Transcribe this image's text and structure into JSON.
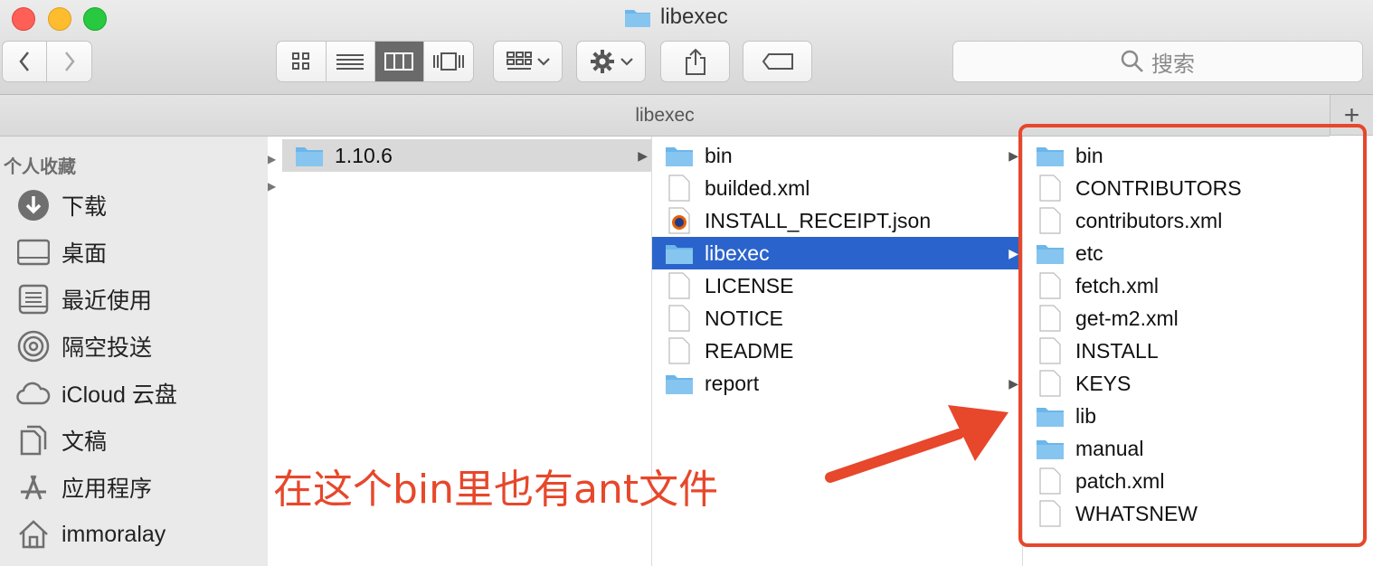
{
  "window": {
    "title": "libexec",
    "path_title": "libexec"
  },
  "toolbar": {
    "search_placeholder": "搜索",
    "plus_label": "+"
  },
  "sidebar": {
    "header": "个人收藏",
    "items": [
      {
        "label": "下载",
        "icon": "download-icon"
      },
      {
        "label": "桌面",
        "icon": "desktop-icon"
      },
      {
        "label": "最近使用",
        "icon": "recents-icon"
      },
      {
        "label": "隔空投送",
        "icon": "airdrop-icon"
      },
      {
        "label": "iCloud 云盘",
        "icon": "cloud-icon"
      },
      {
        "label": "文稿",
        "icon": "documents-icon"
      },
      {
        "label": "应用程序",
        "icon": "applications-icon"
      },
      {
        "label": "immoralay",
        "icon": "home-icon"
      }
    ]
  },
  "columns": {
    "col1": [
      {
        "name": "1.10.6",
        "type": "folder"
      }
    ],
    "col2": [
      {
        "name": "bin",
        "type": "folder"
      },
      {
        "name": "builded.xml",
        "type": "file"
      },
      {
        "name": "INSTALL_RECEIPT.json",
        "type": "json"
      },
      {
        "name": "libexec",
        "type": "folder"
      },
      {
        "name": "LICENSE",
        "type": "file"
      },
      {
        "name": "NOTICE",
        "type": "file"
      },
      {
        "name": "README",
        "type": "file"
      },
      {
        "name": "report",
        "type": "folder"
      }
    ],
    "col3": [
      {
        "name": "bin",
        "type": "folder"
      },
      {
        "name": "CONTRIBUTORS",
        "type": "file"
      },
      {
        "name": "contributors.xml",
        "type": "file"
      },
      {
        "name": "etc",
        "type": "folder"
      },
      {
        "name": "fetch.xml",
        "type": "file"
      },
      {
        "name": "get-m2.xml",
        "type": "file"
      },
      {
        "name": "INSTALL",
        "type": "file"
      },
      {
        "name": "KEYS",
        "type": "file"
      },
      {
        "name": "lib",
        "type": "folder"
      },
      {
        "name": "manual",
        "type": "folder"
      },
      {
        "name": "patch.xml",
        "type": "file"
      },
      {
        "name": "WHATSNEW",
        "type": "file"
      }
    ]
  },
  "annotation": {
    "text": "在这个bin里也有ant文件",
    "color": "#e7472b"
  },
  "colors": {
    "selection": "#2a63cc",
    "folder": "#6cb6ea",
    "accent": "#e7472b"
  }
}
